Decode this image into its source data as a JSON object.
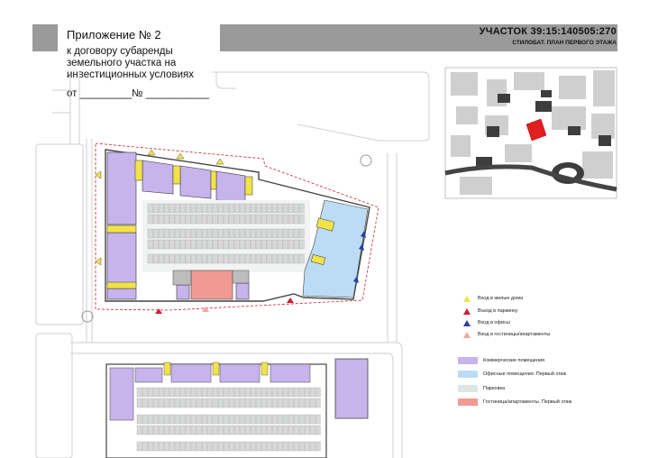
{
  "header": {
    "appendix_title": "Приложение № 2",
    "appendix_lines": [
      "к договору субаренды",
      "земельного участка на",
      "инвестиционных условиях",
      "от _________№ ___________"
    ],
    "plot_id": "УЧАСТОК 39:15:140505:270",
    "plot_subtitle": "СТИЛОБАТ. ПЛАН ПЕРВОГО ЭТАЖА"
  },
  "legend": {
    "entrances": [
      {
        "label": "Вход в жилые дома",
        "color": "#f2e24a",
        "icon": "yellow-triangle-icon"
      },
      {
        "label": "Въезд в паркинку",
        "color": "#d11f2f",
        "icon": "red-triangle-icon"
      },
      {
        "label": "Вход в офисы",
        "color": "#2a3ea8",
        "icon": "blue-triangle-icon"
      },
      {
        "label": "Вход в гостиницы/апартаменты",
        "color": "#f0a6a0",
        "icon": "pink-triangle-icon"
      }
    ],
    "zones": [
      {
        "label": "Коммерческие помещения",
        "color": "#c7b4ec"
      },
      {
        "label": "Офисные помещения. Первый этаж",
        "color": "#bcdcf5"
      },
      {
        "label": "Парковка",
        "color": "#dde6e2"
      },
      {
        "label": "Гостиница/апартаменты. Первый этаж",
        "color": "#f19a94"
      }
    ]
  }
}
